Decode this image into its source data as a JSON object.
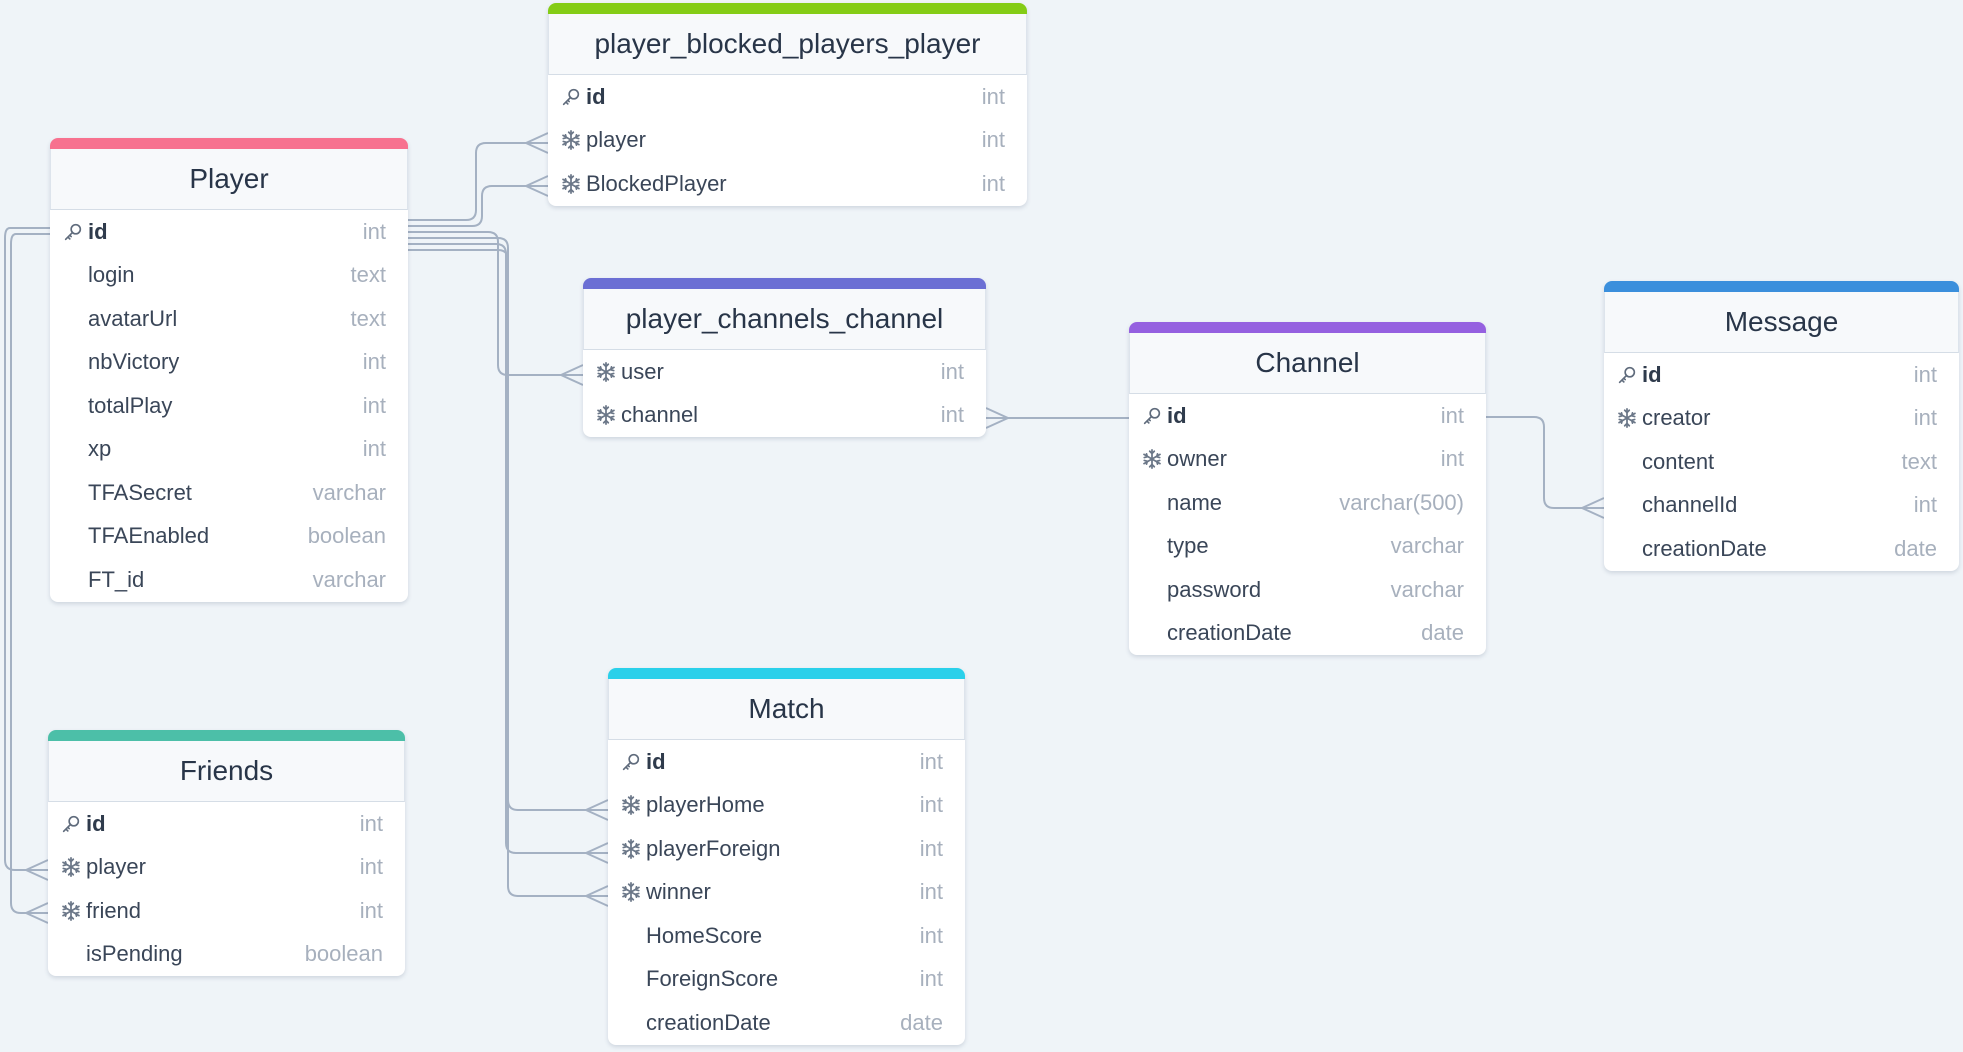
{
  "diagram": {
    "tables": {
      "player": {
        "name": "Player",
        "accent": "#f7718f",
        "columns": [
          {
            "name": "id",
            "type": "int",
            "icon": "key-icon"
          },
          {
            "name": "login",
            "type": "text",
            "icon": ""
          },
          {
            "name": "avatarUrl",
            "type": "text",
            "icon": ""
          },
          {
            "name": "nbVictory",
            "type": "int",
            "icon": ""
          },
          {
            "name": "totalPlay",
            "type": "int",
            "icon": ""
          },
          {
            "name": "xp",
            "type": "int",
            "icon": ""
          },
          {
            "name": "TFASecret",
            "type": "varchar",
            "icon": ""
          },
          {
            "name": "TFAEnabled",
            "type": "boolean",
            "icon": ""
          },
          {
            "name": "FT_id",
            "type": "varchar",
            "icon": ""
          }
        ]
      },
      "blocked": {
        "name": "player_blocked_players_player",
        "accent": "#84cc16",
        "columns": [
          {
            "name": "id",
            "type": "int",
            "icon": "key-icon"
          },
          {
            "name": "player",
            "type": "int",
            "icon": "snowflake-icon"
          },
          {
            "name": "BlockedPlayer",
            "type": "int",
            "icon": "snowflake-icon"
          }
        ]
      },
      "channels": {
        "name": "player_channels_channel",
        "accent": "#6b6fd4",
        "columns": [
          {
            "name": "user",
            "type": "int",
            "icon": "snowflake-icon"
          },
          {
            "name": "channel",
            "type": "int",
            "icon": "snowflake-icon"
          }
        ]
      },
      "channel": {
        "name": "Channel",
        "accent": "#9560e0",
        "columns": [
          {
            "name": "id",
            "type": "int",
            "icon": "key-icon"
          },
          {
            "name": "owner",
            "type": "int",
            "icon": "snowflake-icon"
          },
          {
            "name": "name",
            "type": "varchar(500)",
            "icon": ""
          },
          {
            "name": "type",
            "type": "varchar",
            "icon": ""
          },
          {
            "name": "password",
            "type": "varchar",
            "icon": ""
          },
          {
            "name": "creationDate",
            "type": "date",
            "icon": ""
          }
        ]
      },
      "message": {
        "name": "Message",
        "accent": "#3b8fdc",
        "columns": [
          {
            "name": "id",
            "type": "int",
            "icon": "key-icon"
          },
          {
            "name": "creator",
            "type": "int",
            "icon": "snowflake-icon"
          },
          {
            "name": "content",
            "type": "text",
            "icon": ""
          },
          {
            "name": "channelId",
            "type": "int",
            "icon": ""
          },
          {
            "name": "creationDate",
            "type": "date",
            "icon": ""
          }
        ]
      },
      "friends": {
        "name": "Friends",
        "accent": "#4cbfa8",
        "columns": [
          {
            "name": "id",
            "type": "int",
            "icon": "key-icon"
          },
          {
            "name": "player",
            "type": "int",
            "icon": "snowflake-icon"
          },
          {
            "name": "friend",
            "type": "int",
            "icon": "snowflake-icon"
          },
          {
            "name": "isPending",
            "type": "boolean",
            "icon": ""
          }
        ]
      },
      "match": {
        "name": "Match",
        "accent": "#2ad0ea",
        "columns": [
          {
            "name": "id",
            "type": "int",
            "icon": "key-icon"
          },
          {
            "name": "playerHome",
            "type": "int",
            "icon": "snowflake-icon"
          },
          {
            "name": "playerForeign",
            "type": "int",
            "icon": "snowflake-icon"
          },
          {
            "name": "winner",
            "type": "int",
            "icon": "snowflake-icon"
          },
          {
            "name": "HomeScore",
            "type": "int",
            "icon": ""
          },
          {
            "name": "ForeignScore",
            "type": "int",
            "icon": ""
          },
          {
            "name": "creationDate",
            "type": "date",
            "icon": ""
          }
        ]
      }
    },
    "line_color": "#a4b1c3"
  }
}
